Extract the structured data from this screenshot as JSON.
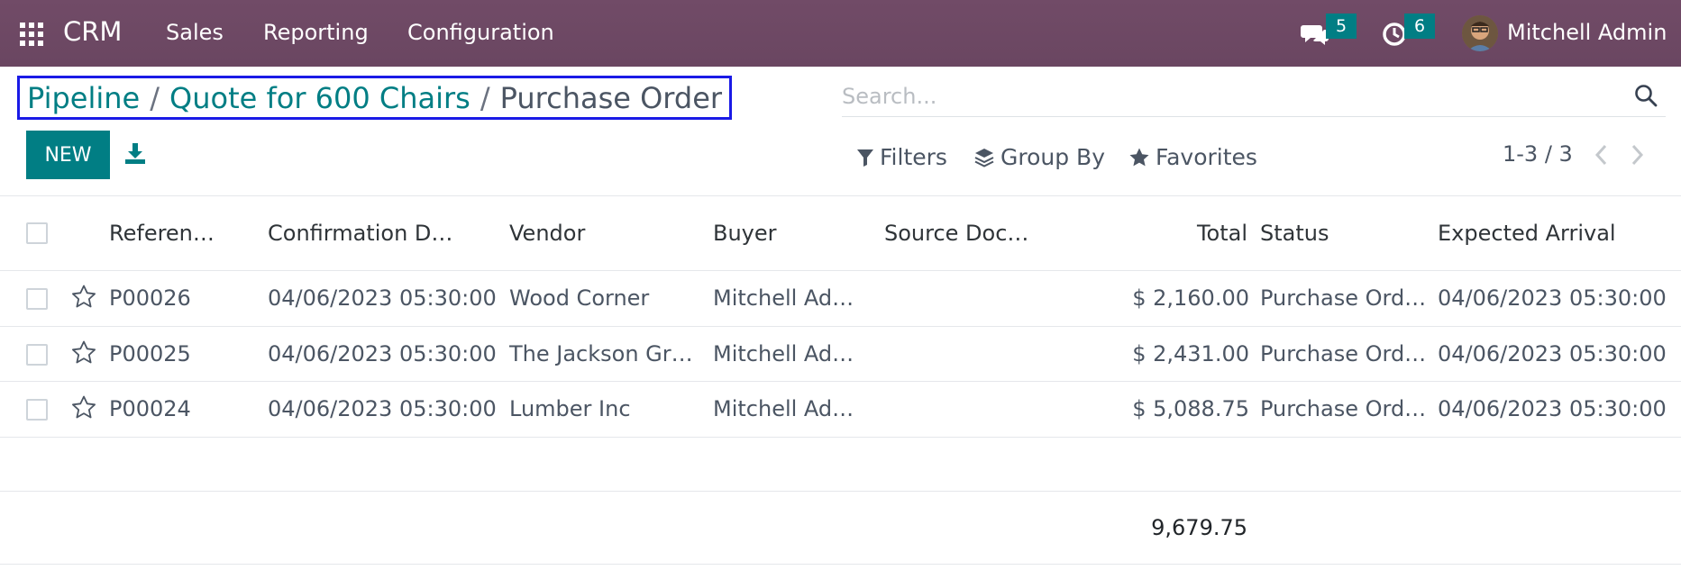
{
  "nav": {
    "app_name": "CRM",
    "menus": [
      "Sales",
      "Reporting",
      "Configuration"
    ],
    "messages_count": "5",
    "activities_count": "6",
    "user_name": "Mitchell Admin",
    "bar_color": "#714B67"
  },
  "breadcrumb": {
    "items": [
      "Pipeline",
      "Quote for 600 Chairs"
    ],
    "separator": "/",
    "current": "Purchase Order"
  },
  "search": {
    "placeholder": "Search..."
  },
  "toolbar": {
    "new_label": "NEW",
    "filters_label": "Filters",
    "group_by_label": "Group By",
    "favorites_label": "Favorites",
    "pager": "1-3 / 3",
    "accent_color": "#017E84"
  },
  "table": {
    "columns": [
      "Referen…",
      "Confirmation D…",
      "Vendor",
      "Buyer",
      "Source Doc…",
      "Total",
      "Status",
      "Expected Arrival"
    ],
    "rows": [
      [
        "P00026",
        "04/06/2023 05:30:00",
        "Wood Corner",
        "Mitchell Ad…",
        "",
        "$ 2,160.00",
        "Purchase Ord…",
        "04/06/2023 05:30:00"
      ],
      [
        "P00025",
        "04/06/2023 05:30:00",
        "The Jackson Gr…",
        "Mitchell Ad…",
        "",
        "$ 2,431.00",
        "Purchase Ord…",
        "04/06/2023 05:30:00"
      ],
      [
        "P00024",
        "04/06/2023 05:30:00",
        "Lumber Inc",
        "Mitchell Ad…",
        "",
        "$ 5,088.75",
        "Purchase Ord…",
        "04/06/2023 05:30:00"
      ]
    ],
    "total": "9,679.75"
  }
}
